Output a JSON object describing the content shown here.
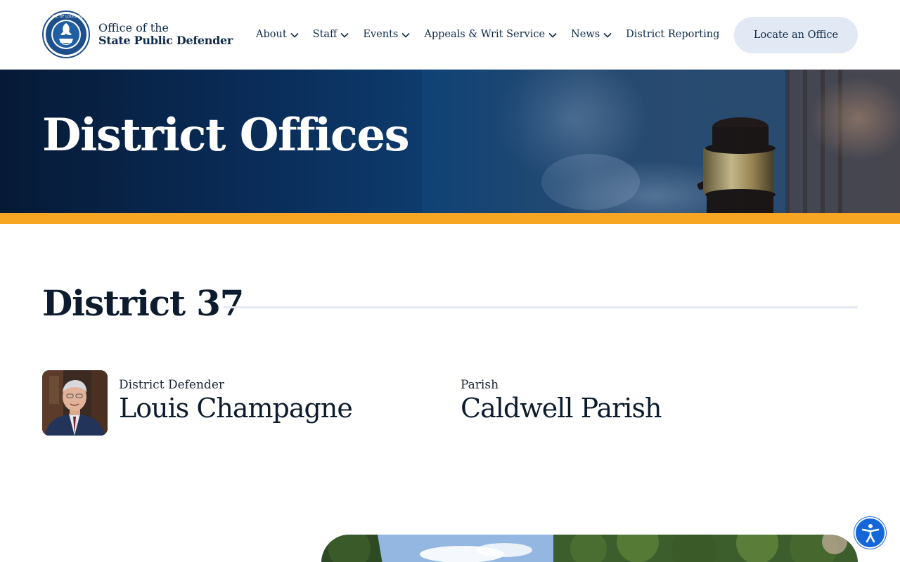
{
  "header": {
    "logo": {
      "line1": "Office of the",
      "line2": "State Public Defender",
      "seal_icon": "louisiana-state-seal-icon"
    },
    "nav": [
      {
        "label": "About",
        "has_dropdown": true
      },
      {
        "label": "Staff",
        "has_dropdown": true
      },
      {
        "label": "Events",
        "has_dropdown": true
      },
      {
        "label": "Appeals & Writ Service",
        "has_dropdown": true
      },
      {
        "label": "News",
        "has_dropdown": true
      },
      {
        "label": "District Reporting",
        "has_dropdown": false
      }
    ],
    "cta_label": "Locate an Office"
  },
  "hero": {
    "title": "District Offices",
    "image_icon": "gavel-photo",
    "accent_color": "#f6a623"
  },
  "district": {
    "heading": "District 37",
    "defender_label": "District Defender",
    "defender_name": "Louis Champagne",
    "parish_label": "Parish",
    "parish_name": "Caldwell Parish"
  },
  "colors": {
    "navy": "#0f2a4a",
    "cta_bg": "#e3e9f4",
    "accent": "#f6a623",
    "a11y_blue": "#1566d8"
  },
  "accessibility": {
    "icon": "accessibility-person-icon"
  }
}
